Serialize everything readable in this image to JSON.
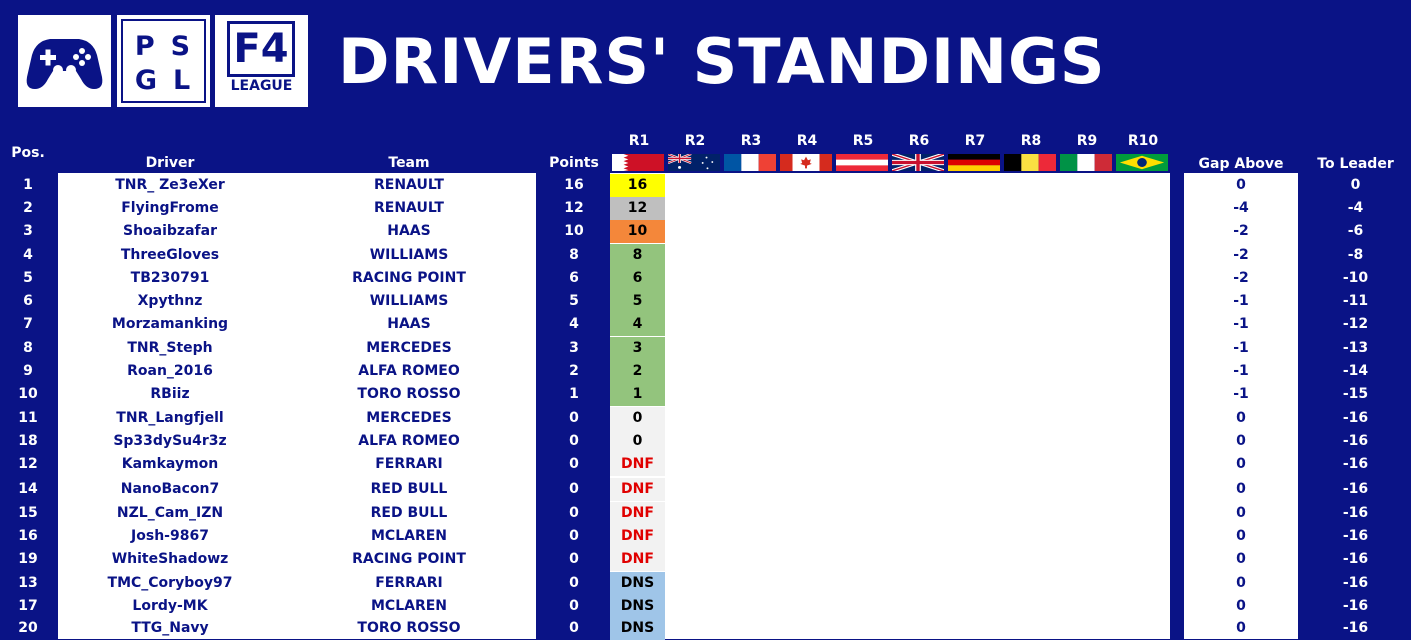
{
  "header": {
    "title": "DRIVERS' STANDINGS",
    "logo_psgl_line1": "PS",
    "logo_psgl_line2": "GL",
    "logo_f4_big": "F4",
    "logo_f4_small": "LEAGUE"
  },
  "columns": {
    "pos": "Pos.",
    "driver": "Driver",
    "team": "Team",
    "points": "Points",
    "gap_above": "Gap Above",
    "to_leader": "To Leader"
  },
  "rounds": [
    {
      "label": "R1",
      "flag": "bahrain-flag"
    },
    {
      "label": "R2",
      "flag": "australia-flag"
    },
    {
      "label": "R3",
      "flag": "france-flag"
    },
    {
      "label": "R4",
      "flag": "canada-flag"
    },
    {
      "label": "R5",
      "flag": "austria-flag"
    },
    {
      "label": "R6",
      "flag": "great-britain-flag"
    },
    {
      "label": "R7",
      "flag": "germany-flag"
    },
    {
      "label": "R8",
      "flag": "belgium-flag"
    },
    {
      "label": "R9",
      "flag": "italy-flag"
    },
    {
      "label": "R10",
      "flag": "brazil-flag"
    }
  ],
  "colors": {
    "background": "#0a1386",
    "gold": "#ffff00",
    "silver": "#bfbfbf",
    "bronze": "#f4873a",
    "points": "#93c47d",
    "zero": "#f2f2f2",
    "dnf": "#f2f2f2",
    "dns": "#9fc5e8"
  },
  "rows": [
    {
      "pos": "1",
      "driver": "TNR_ Ze3eXer",
      "team": "RENAULT",
      "points": "16",
      "r1": "16",
      "r1_type": "gold",
      "gap": "0",
      "leader": "0"
    },
    {
      "pos": "2",
      "driver": "FlyingFrome",
      "team": "RENAULT",
      "points": "12",
      "r1": "12",
      "r1_type": "silver",
      "gap": "-4",
      "leader": "-4"
    },
    {
      "pos": "3",
      "driver": "Shoaibzafar",
      "team": "HAAS",
      "points": "10",
      "r1": "10",
      "r1_type": "bronze",
      "gap": "-2",
      "leader": "-6"
    },
    {
      "pos": "4",
      "driver": "ThreeGloves",
      "team": "WILLIAMS",
      "points": "8",
      "r1": "8",
      "r1_type": "points",
      "gap": "-2",
      "leader": "-8"
    },
    {
      "pos": "5",
      "driver": "TB230791",
      "team": "RACING POINT",
      "points": "6",
      "r1": "6",
      "r1_type": "points",
      "gap": "-2",
      "leader": "-10"
    },
    {
      "pos": "6",
      "driver": "Xpythnz",
      "team": "WILLIAMS",
      "points": "5",
      "r1": "5",
      "r1_type": "points",
      "gap": "-1",
      "leader": "-11"
    },
    {
      "pos": "7",
      "driver": "Morzamanking",
      "team": "HAAS",
      "points": "4",
      "r1": "4",
      "r1_type": "points",
      "gap": "-1",
      "leader": "-12"
    },
    {
      "pos": "8",
      "driver": "TNR_Steph",
      "team": "MERCEDES",
      "points": "3",
      "r1": "3",
      "r1_type": "points",
      "gap": "-1",
      "leader": "-13"
    },
    {
      "pos": "9",
      "driver": "Roan_2016",
      "team": "ALFA ROMEO",
      "points": "2",
      "r1": "2",
      "r1_type": "points",
      "gap": "-1",
      "leader": "-14"
    },
    {
      "pos": "10",
      "driver": "RBiiz",
      "team": "TORO ROSSO",
      "points": "1",
      "r1": "1",
      "r1_type": "points",
      "gap": "-1",
      "leader": "-15"
    },
    {
      "pos": "11",
      "driver": "TNR_Langfjell",
      "team": "MERCEDES",
      "points": "0",
      "r1": "0",
      "r1_type": "zero",
      "gap": "0",
      "leader": "-16"
    },
    {
      "pos": "18",
      "driver": "Sp33dySu4r3z",
      "team": "ALFA ROMEO",
      "points": "0",
      "r1": "0",
      "r1_type": "zero",
      "gap": "0",
      "leader": "-16"
    },
    {
      "pos": "12",
      "driver": "Kamkaymon",
      "team": "FERRARI",
      "points": "0",
      "r1": "DNF",
      "r1_type": "dnf",
      "gap": "0",
      "leader": "-16"
    },
    {
      "pos": "14",
      "driver": "NanoBacon7",
      "team": "RED BULL",
      "points": "0",
      "r1": "DNF",
      "r1_type": "dnf",
      "gap": "0",
      "leader": "-16"
    },
    {
      "pos": "15",
      "driver": "NZL_Cam_IZN",
      "team": "RED BULL",
      "points": "0",
      "r1": "DNF",
      "r1_type": "dnf",
      "gap": "0",
      "leader": "-16"
    },
    {
      "pos": "16",
      "driver": "Josh-9867",
      "team": "MCLAREN",
      "points": "0",
      "r1": "DNF",
      "r1_type": "dnf",
      "gap": "0",
      "leader": "-16"
    },
    {
      "pos": "19",
      "driver": "WhiteShadowz",
      "team": "RACING POINT",
      "points": "0",
      "r1": "DNF",
      "r1_type": "dnf",
      "gap": "0",
      "leader": "-16"
    },
    {
      "pos": "13",
      "driver": "TMC_Coryboy97",
      "team": "FERRARI",
      "points": "0",
      "r1": "DNS",
      "r1_type": "dns",
      "gap": "0",
      "leader": "-16"
    },
    {
      "pos": "17",
      "driver": "Lordy-MK",
      "team": "MCLAREN",
      "points": "0",
      "r1": "DNS",
      "r1_type": "dns",
      "gap": "0",
      "leader": "-16"
    },
    {
      "pos": "20",
      "driver": "TTG_Navy",
      "team": "TORO ROSSO",
      "points": "0",
      "r1": "DNS",
      "r1_type": "dns",
      "gap": "0",
      "leader": "-16"
    }
  ]
}
